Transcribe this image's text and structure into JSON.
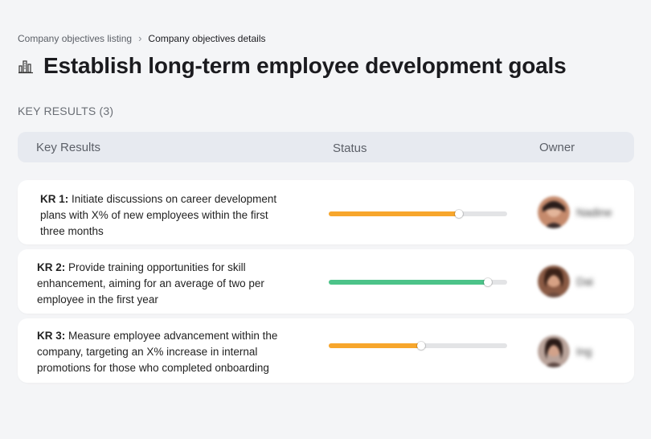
{
  "breadcrumb": {
    "parent": "Company objectives listing",
    "separator": "›",
    "current": "Company objectives details"
  },
  "page": {
    "icon": "building-chart-icon",
    "title": "Establish long-term employee development goals"
  },
  "key_results_section": {
    "label": "KEY RESULTS (3)",
    "columns": [
      "Key Results",
      "Status",
      "Owner"
    ]
  },
  "colors": {
    "orange": "#f7a62c",
    "green": "#4cc389",
    "track": "#e3e4e6"
  },
  "rows": [
    {
      "label": "KR 1:",
      "text": "Initiate discussions on career development plans with X% of new employees within the first three months",
      "progress": 0.73,
      "status_color": "orange",
      "owner": "Nadine"
    },
    {
      "label": "KR 2:",
      "text": "Provide training opportunities for skill enhancement, aiming for an average of two per employee in the first year",
      "progress": 0.89,
      "status_color": "green",
      "owner": "Dai"
    },
    {
      "label": "KR 3:",
      "text": "Measure employee advancement within the company, targeting an X% increase in internal promotions for those who completed onboarding",
      "progress": 0.52,
      "status_color": "orange",
      "owner": "Ing"
    }
  ]
}
